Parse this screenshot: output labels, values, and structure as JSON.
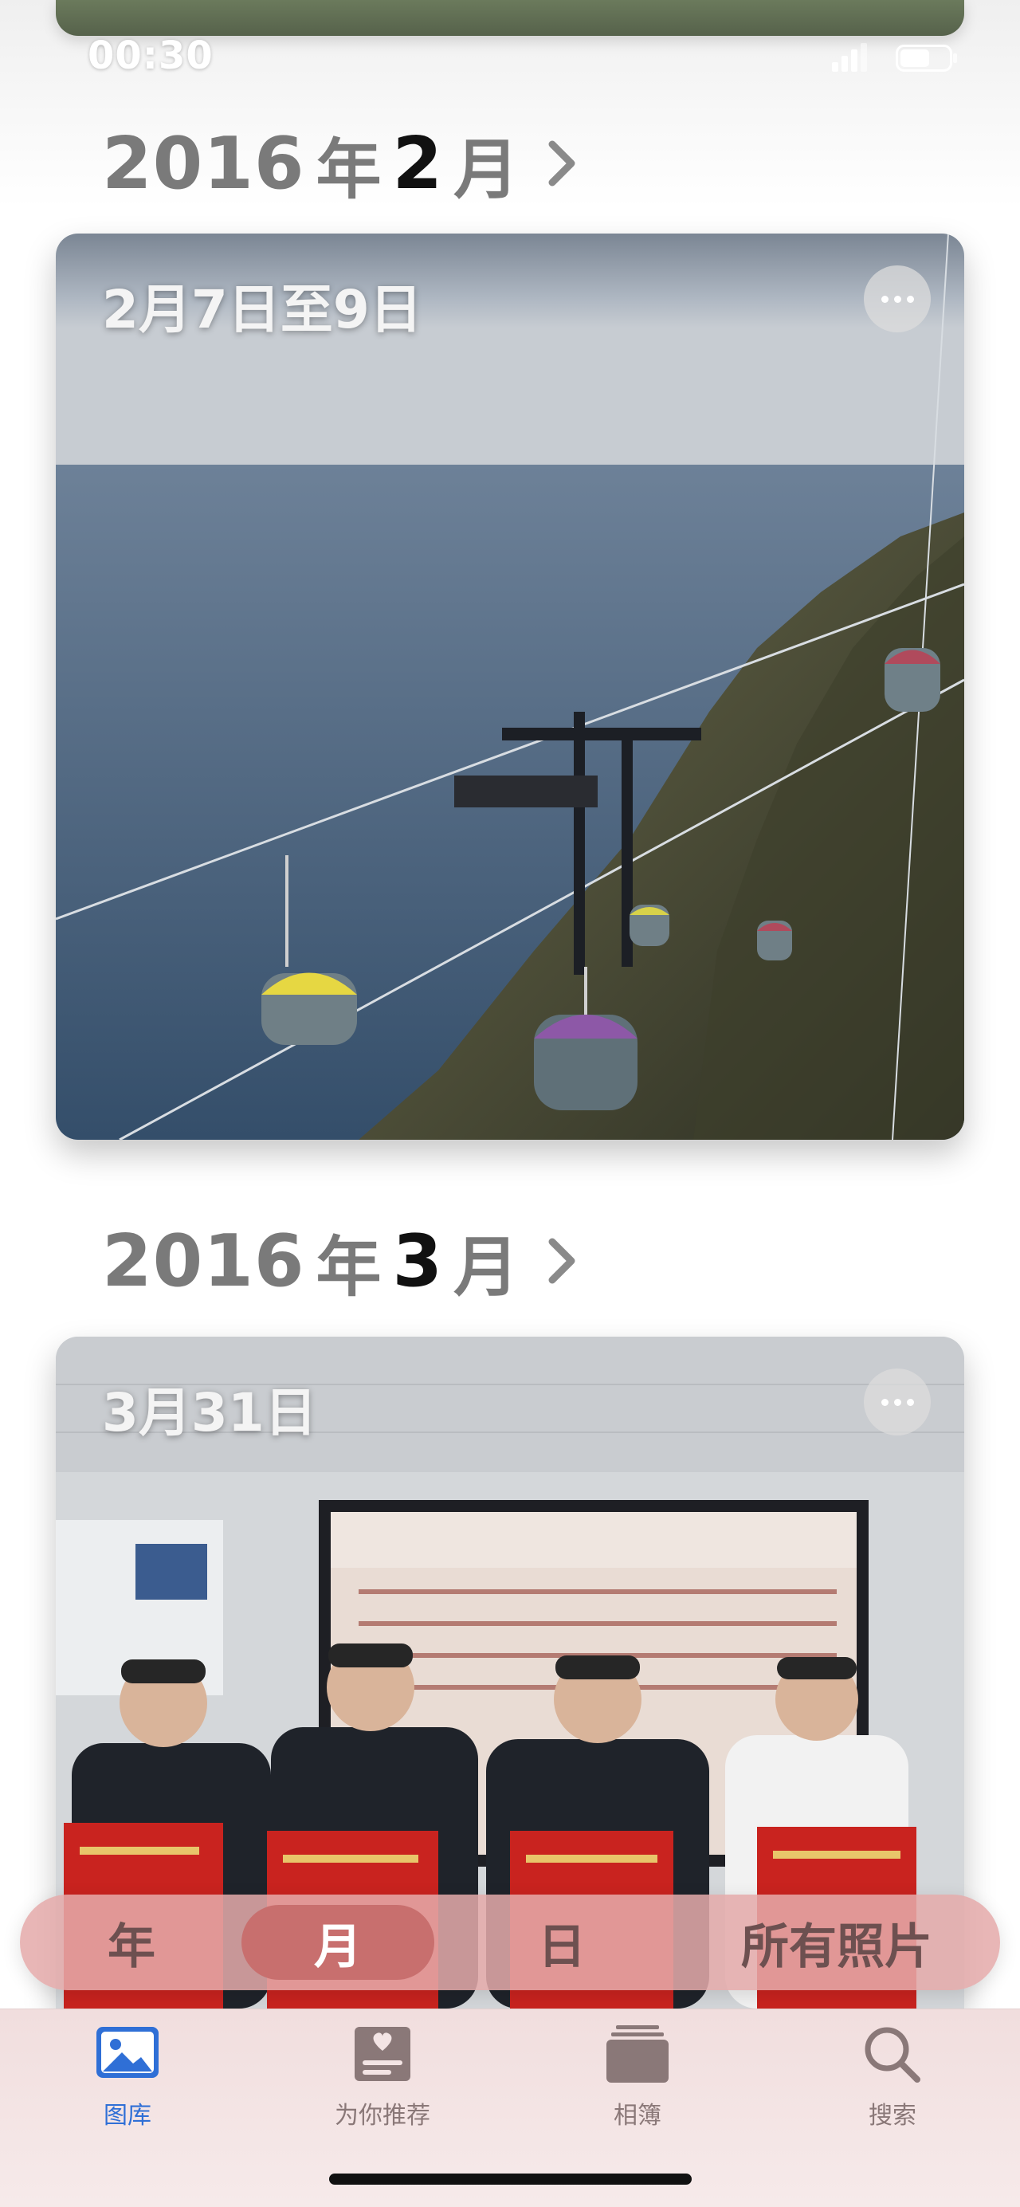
{
  "status_bar": {
    "time": "00:30",
    "icons": [
      "signal-icon",
      "battery-icon"
    ]
  },
  "sections": [
    {
      "year": "2016",
      "year_unit": "年",
      "month": "2",
      "month_unit": "月",
      "card": {
        "date_label": "2月7日至9日",
        "scene": "cable cars over sea coast"
      }
    },
    {
      "year": "2016",
      "year_unit": "年",
      "month": "3",
      "month_unit": "月",
      "card": {
        "date_label": "3月31日",
        "scene": "award ceremony in meeting room"
      }
    }
  ],
  "segmented_control": {
    "items": [
      "年",
      "月",
      "日",
      "所有照片"
    ],
    "selected": "月"
  },
  "tab_bar": {
    "items": [
      {
        "label": "图库",
        "icon": "photo-library-icon",
        "active": true
      },
      {
        "label": "为你推荐",
        "icon": "for-you-icon",
        "active": false
      },
      {
        "label": "相簿",
        "icon": "albums-icon",
        "active": false
      },
      {
        "label": "搜索",
        "icon": "search-icon",
        "active": false
      }
    ]
  },
  "colors": {
    "accent": "#2f6fd6",
    "segment_bg": "#e4aaaa",
    "segment_selected": "#c86f6e"
  }
}
